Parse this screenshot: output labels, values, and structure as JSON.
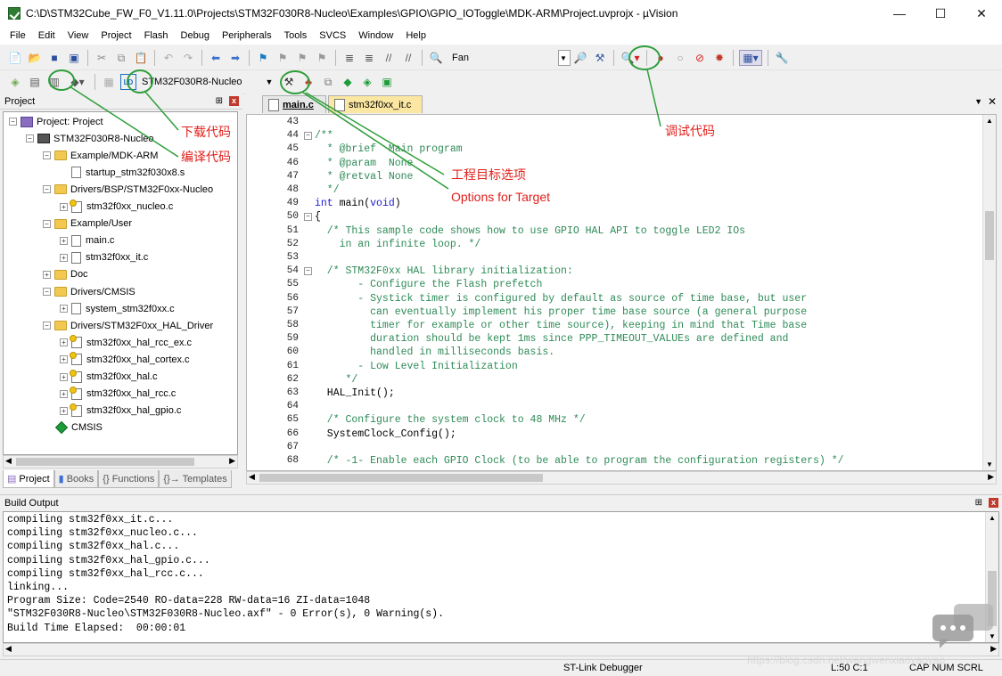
{
  "window": {
    "title": "C:\\D\\STM32Cube_FW_F0_V1.11.0\\Projects\\STM32F030R8-Nucleo\\Examples\\GPIO\\GPIO_IOToggle\\MDK-ARM\\Project.uvprojx - µVision",
    "minimize": "—",
    "maximize": "☐",
    "close": "✕"
  },
  "menu": [
    "File",
    "Edit",
    "View",
    "Project",
    "Flash",
    "Debug",
    "Peripherals",
    "Tools",
    "SVCS",
    "Window",
    "Help"
  ],
  "toolbar1": {
    "find_value": "Fan"
  },
  "toolbar2": {
    "target": "STM32F030R8-Nucleo"
  },
  "project_panel": {
    "title": "Project",
    "pin": "⊞",
    "close": "x",
    "tree": [
      {
        "label": "Project: Project",
        "level": 0,
        "expander": "−",
        "icon": "project-icon"
      },
      {
        "label": "STM32F030R8-Nucleo",
        "level": 1,
        "expander": "−",
        "icon": "target-icon"
      },
      {
        "label": "Example/MDK-ARM",
        "level": 2,
        "expander": "−",
        "icon": "folder-icon"
      },
      {
        "label": "startup_stm32f030x8.s",
        "level": 3,
        "expander": "",
        "icon": "file-icon"
      },
      {
        "label": "Drivers/BSP/STM32F0xx-Nucleo",
        "level": 2,
        "expander": "−",
        "icon": "folder-icon"
      },
      {
        "label": "stm32f0xx_nucleo.c",
        "level": 3,
        "expander": "+",
        "icon": "c-file-icon"
      },
      {
        "label": "Example/User",
        "level": 2,
        "expander": "−",
        "icon": "folder-icon"
      },
      {
        "label": "main.c",
        "level": 3,
        "expander": "+",
        "icon": "file-icon"
      },
      {
        "label": "stm32f0xx_it.c",
        "level": 3,
        "expander": "+",
        "icon": "file-icon"
      },
      {
        "label": "Doc",
        "level": 2,
        "expander": "+",
        "icon": "folder-icon"
      },
      {
        "label": "Drivers/CMSIS",
        "level": 2,
        "expander": "−",
        "icon": "folder-icon"
      },
      {
        "label": "system_stm32f0xx.c",
        "level": 3,
        "expander": "+",
        "icon": "file-icon"
      },
      {
        "label": "Drivers/STM32F0xx_HAL_Driver",
        "level": 2,
        "expander": "−",
        "icon": "folder-icon"
      },
      {
        "label": "stm32f0xx_hal_rcc_ex.c",
        "level": 3,
        "expander": "+",
        "icon": "c-file-icon"
      },
      {
        "label": "stm32f0xx_hal_cortex.c",
        "level": 3,
        "expander": "+",
        "icon": "c-file-icon"
      },
      {
        "label": "stm32f0xx_hal.c",
        "level": 3,
        "expander": "+",
        "icon": "c-file-icon"
      },
      {
        "label": "stm32f0xx_hal_rcc.c",
        "level": 3,
        "expander": "+",
        "icon": "c-file-icon"
      },
      {
        "label": "stm32f0xx_hal_gpio.c",
        "level": 3,
        "expander": "+",
        "icon": "c-file-icon"
      },
      {
        "label": "CMSIS",
        "level": 2,
        "expander": "",
        "icon": "cmsis-diamond-icon"
      }
    ],
    "tabs": [
      "Project",
      "Books",
      "{} Functions",
      "{}→ Templates"
    ]
  },
  "editor": {
    "tabs": [
      "main.c",
      "stm32f0xx_it.c"
    ],
    "lines": [
      {
        "n": "43",
        "fold": "",
        "parts": [
          [
            "",
            ""
          ]
        ]
      },
      {
        "n": "44",
        "fold": "−",
        "parts": [
          [
            "cmt",
            "/**"
          ]
        ]
      },
      {
        "n": "45",
        "fold": "",
        "parts": [
          [
            "cmt",
            "  * @brief  Main program"
          ]
        ]
      },
      {
        "n": "46",
        "fold": "",
        "parts": [
          [
            "cmt",
            "  * @param  None"
          ]
        ]
      },
      {
        "n": "47",
        "fold": "",
        "parts": [
          [
            "cmt",
            "  * @retval None"
          ]
        ]
      },
      {
        "n": "48",
        "fold": "",
        "parts": [
          [
            "cmt",
            "  */"
          ]
        ]
      },
      {
        "n": "49",
        "fold": "",
        "parts": [
          [
            "kw",
            "int"
          ],
          [
            "",
            " main("
          ],
          [
            "kw",
            "void"
          ],
          [
            "",
            ")"
          ]
        ]
      },
      {
        "n": "50",
        "fold": "−",
        "parts": [
          [
            "",
            "{"
          ]
        ]
      },
      {
        "n": "51",
        "fold": "",
        "parts": [
          [
            "cmt",
            "  /* This sample code shows how to use GPIO HAL API to toggle LED2 IOs"
          ]
        ]
      },
      {
        "n": "52",
        "fold": "",
        "parts": [
          [
            "cmt",
            "    in an infinite loop. */"
          ]
        ]
      },
      {
        "n": "53",
        "fold": "",
        "parts": [
          [
            "",
            ""
          ]
        ]
      },
      {
        "n": "54",
        "fold": "−",
        "parts": [
          [
            "cmt",
            "  /* STM32F0xx HAL library initialization:"
          ]
        ]
      },
      {
        "n": "55",
        "fold": "",
        "parts": [
          [
            "cmt",
            "       - Configure the Flash prefetch"
          ]
        ]
      },
      {
        "n": "56",
        "fold": "",
        "parts": [
          [
            "cmt",
            "       - Systick timer is configured by default as source of time base, but user"
          ]
        ]
      },
      {
        "n": "57",
        "fold": "",
        "parts": [
          [
            "cmt",
            "         can eventually implement his proper time base source (a general purpose"
          ]
        ]
      },
      {
        "n": "58",
        "fold": "",
        "parts": [
          [
            "cmt",
            "         timer for example or other time source), keeping in mind that Time base"
          ]
        ]
      },
      {
        "n": "59",
        "fold": "",
        "parts": [
          [
            "cmt",
            "         duration should be kept 1ms since PPP_TIMEOUT_VALUEs are defined and"
          ]
        ]
      },
      {
        "n": "60",
        "fold": "",
        "parts": [
          [
            "cmt",
            "         handled in milliseconds basis."
          ]
        ]
      },
      {
        "n": "61",
        "fold": "",
        "parts": [
          [
            "cmt",
            "       - Low Level Initialization"
          ]
        ]
      },
      {
        "n": "62",
        "fold": "",
        "parts": [
          [
            "cmt",
            "     */"
          ]
        ]
      },
      {
        "n": "63",
        "fold": "",
        "parts": [
          [
            "",
            "  HAL_Init();"
          ]
        ]
      },
      {
        "n": "64",
        "fold": "",
        "parts": [
          [
            "",
            ""
          ]
        ]
      },
      {
        "n": "65",
        "fold": "",
        "parts": [
          [
            "cmt",
            "  /* Configure the system clock to 48 MHz */"
          ]
        ]
      },
      {
        "n": "66",
        "fold": "",
        "parts": [
          [
            "",
            "  SystemClock_Config();"
          ]
        ]
      },
      {
        "n": "67",
        "fold": "",
        "parts": [
          [
            "",
            ""
          ]
        ]
      },
      {
        "n": "68",
        "fold": "",
        "parts": [
          [
            "cmt",
            "  /* -1- Enable each GPIO Clock (to be able to program the configuration registers) */"
          ]
        ]
      }
    ]
  },
  "build_output": {
    "title": "Build Output",
    "lines": [
      "compiling stm32f0xx_it.c...",
      "compiling stm32f0xx_nucleo.c...",
      "compiling stm32f0xx_hal.c...",
      "compiling stm32f0xx_hal_gpio.c...",
      "compiling stm32f0xx_hal_rcc.c...",
      "linking...",
      "Program Size: Code=2540 RO-data=228 RW-data=16 ZI-data=1048",
      "\"STM32F030R8-Nucleo\\STM32F030R8-Nucleo.axf\" - 0 Error(s), 0 Warning(s).",
      "Build Time Elapsed:  00:00:01"
    ]
  },
  "status": {
    "debugger": "ST-Link Debugger",
    "position": "L:50 C:1",
    "caps": "CAP  NUM  SCRL"
  },
  "annotations": {
    "download": "下载代码",
    "compile": "编译代码",
    "project_options": "工程目标选项",
    "options_for_target": "Options for Target",
    "debug": "调试代码"
  },
  "watermark": "https://blog.csdn.net/wangwenxiaoyaoyao",
  "colors": {
    "annot_red": "#e0201b",
    "annot_green": "#2e9e3a",
    "comment_green": "#2e8b57",
    "keyword_blue": "#1c1ccc"
  }
}
